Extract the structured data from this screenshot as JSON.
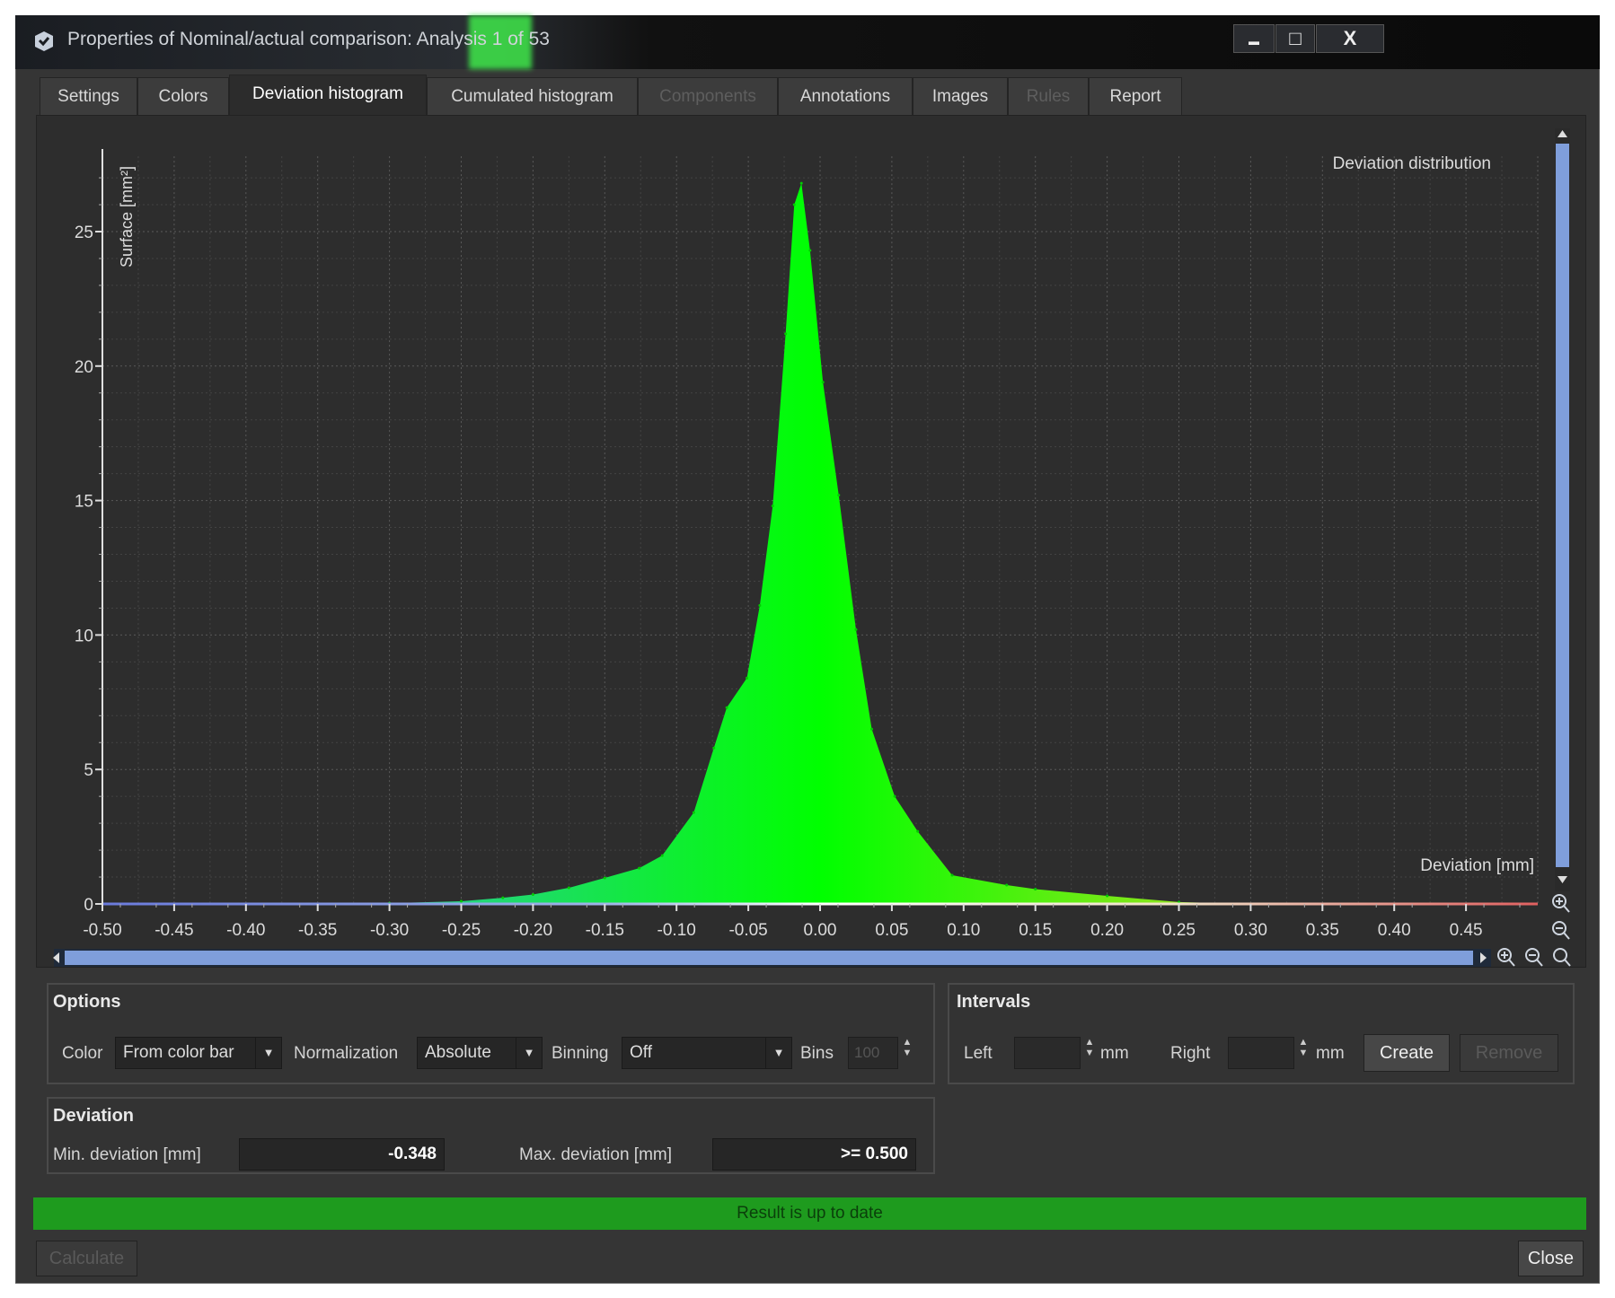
{
  "window": {
    "title": "Properties of Nominal/actual comparison: Analysis 1 of 53",
    "minimize_label": "▬",
    "maximize_label": "□",
    "close_label": "X"
  },
  "tabs": [
    {
      "label": "Settings",
      "state": "normal"
    },
    {
      "label": "Colors",
      "state": "normal"
    },
    {
      "label": "Deviation histogram",
      "state": "active"
    },
    {
      "label": "Cumulated histogram",
      "state": "normal"
    },
    {
      "label": "Components",
      "state": "disabled"
    },
    {
      "label": "Annotations",
      "state": "normal"
    },
    {
      "label": "Images",
      "state": "normal"
    },
    {
      "label": "Rules",
      "state": "disabled"
    },
    {
      "label": "Report",
      "state": "normal"
    }
  ],
  "chart_data": {
    "type": "area",
    "title": "Deviation distribution",
    "xlabel": "Deviation [mm]",
    "ylabel": "Surface [mm²]",
    "xlim": [
      -0.5,
      0.5
    ],
    "ylim": [
      0,
      27.8
    ],
    "x_tick_labels": [
      "-0.50",
      "-0.45",
      "-0.40",
      "-0.35",
      "-0.30",
      "-0.25",
      "-0.20",
      "-0.15",
      "-0.10",
      "-0.05",
      "0.00",
      "0.05",
      "0.10",
      "0.15",
      "0.20",
      "0.25",
      "0.30",
      "0.35",
      "0.40",
      "0.45"
    ],
    "y_tick_labels": [
      "0",
      "5",
      "10",
      "15",
      "20",
      "25"
    ],
    "grid": true,
    "x": [
      -0.35,
      -0.3,
      -0.25,
      -0.221,
      -0.2,
      -0.175,
      -0.15,
      -0.126,
      -0.11,
      -0.088,
      -0.074,
      -0.065,
      -0.051,
      -0.042,
      -0.033,
      -0.024,
      -0.018,
      -0.013,
      -0.007,
      0.002,
      0.013,
      0.025,
      0.036,
      0.052,
      0.068,
      0.092,
      0.13,
      0.15,
      0.2,
      0.25,
      0.3
    ],
    "y": [
      0.0,
      0.03,
      0.1,
      0.23,
      0.35,
      0.6,
      0.97,
      1.33,
      1.8,
      3.4,
      5.8,
      7.3,
      8.4,
      11.1,
      14.8,
      21.2,
      26.0,
      26.8,
      24.3,
      19.4,
      15.2,
      10.2,
      6.5,
      4.0,
      2.7,
      1.07,
      0.7,
      0.55,
      0.3,
      0.07,
      0.0
    ],
    "fill_colors": [
      "#2ec8a0",
      "#00ff00",
      "#a8e020"
    ]
  },
  "options": {
    "title": "Options",
    "color_label": "Color",
    "color_value": "From color bar",
    "normalization_label": "Normalization",
    "normalization_value": "Absolute",
    "binning_label": "Binning",
    "binning_value": "Off",
    "bins_label": "Bins",
    "bins_value": "100"
  },
  "intervals": {
    "title": "Intervals",
    "left_label": "Left",
    "right_label": "Right",
    "unit": "mm",
    "create_label": "Create",
    "remove_label": "Remove"
  },
  "deviation": {
    "title": "Deviation",
    "min_label": "Min. deviation [mm]",
    "min_value": "-0.348",
    "max_label": "Max. deviation [mm]",
    "max_value": ">= 0.500"
  },
  "status": {
    "text": "Result is up to date",
    "color": "#1e9b1e"
  },
  "footer": {
    "calculate_label": "Calculate",
    "close_label": "Close"
  }
}
